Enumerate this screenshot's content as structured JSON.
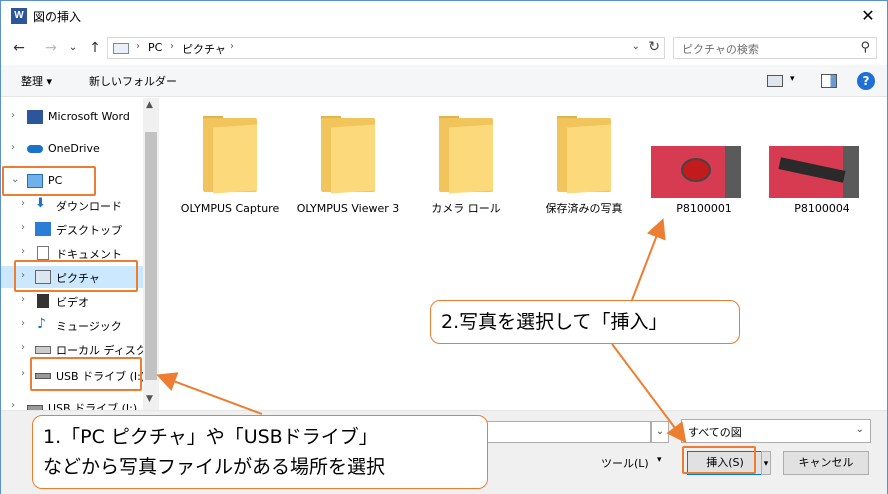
{
  "titlebar": {
    "app_icon": "W",
    "title": "図の挿入",
    "close": "✕"
  },
  "nav": {
    "back": "←",
    "forward": "→",
    "dropdown": "⌄",
    "up": "↑",
    "path": [
      "PC",
      "ピクチャ"
    ],
    "sep": "›",
    "addr_dropdown": "⌄",
    "refresh": "↻",
    "search_placeholder": "ピクチャの検索",
    "search_icon": "⚲"
  },
  "toolbar": {
    "organize": "整理 ▾",
    "new_folder": "新しいフォルダー",
    "view_drop": "▾",
    "help": "?"
  },
  "sidebar": {
    "up": "▲",
    "down": "▼",
    "items": [
      {
        "label": "Microsoft Word",
        "chev": "›",
        "icon": "word-icon"
      },
      {
        "label": "OneDrive",
        "chev": "›",
        "icon": "cloud-icon"
      },
      {
        "label": "PC",
        "chev": "⌄",
        "icon": "pc-icon"
      },
      {
        "label": "ダウンロード",
        "chev": "›",
        "icon": "download-icon"
      },
      {
        "label": "デスクトップ",
        "chev": "›",
        "icon": "desktop-icon"
      },
      {
        "label": "ドキュメント",
        "chev": "›",
        "icon": "document-icon"
      },
      {
        "label": "ピクチャ",
        "chev": "›",
        "icon": "pictures-icon"
      },
      {
        "label": "ビデオ",
        "chev": "›",
        "icon": "video-icon"
      },
      {
        "label": "ミュージック",
        "chev": "›",
        "icon": "music-icon"
      },
      {
        "label": "ローカル ディスク (C",
        "chev": "›",
        "icon": "disk-icon"
      },
      {
        "label": "USB ドライブ (I:)",
        "chev": "›",
        "icon": "usb-icon"
      },
      {
        "label": "USB ドライブ (I:)",
        "chev": "›",
        "icon": "usb-icon"
      }
    ]
  },
  "content": {
    "items": [
      {
        "type": "folder",
        "label": "OLYMPUS Capture"
      },
      {
        "type": "folder",
        "label": "OLYMPUS Viewer 3"
      },
      {
        "type": "folder",
        "label": "カメラ ロール"
      },
      {
        "type": "folder",
        "label": "保存済みの写真"
      },
      {
        "type": "photo",
        "label": "P8100001"
      },
      {
        "type": "photo",
        "label": "P8100004"
      }
    ]
  },
  "bottom": {
    "fname_drop": "⌄",
    "filter": "すべての図",
    "filter_drop": "⌄",
    "tools": "ツール(L)",
    "tools_drop": "▾",
    "insert": "挿入(S)",
    "insert_split": "▾",
    "cancel": "キャンセル"
  },
  "annotations": {
    "callout1_line1": "1.「PC ピクチャ」や「USBドライブ」",
    "callout1_line2": "などから写真ファイルがある場所を選択",
    "callout2": "2.写真を選択して「挿入」"
  },
  "colors": {
    "accent": "#ed7d31",
    "selection": "#cce8ff",
    "folder": "#f2c55c"
  }
}
